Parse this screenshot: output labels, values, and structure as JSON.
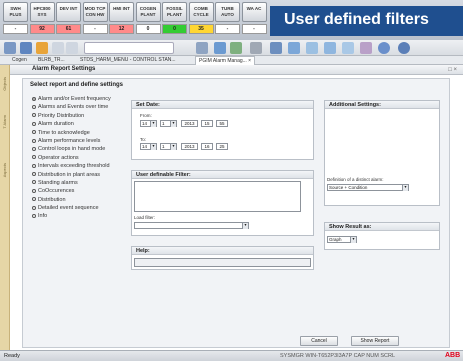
{
  "top_buttons": [
    {
      "label": "SWH PLUS",
      "value": "-",
      "color": "#ffffff"
    },
    {
      "label": "HPC800 SYS",
      "value": "92",
      "color": "#ff8a8a"
    },
    {
      "label": "DEV INT",
      "value": "61",
      "color": "#ff8a8a"
    },
    {
      "label": "MOD TCP CON HW",
      "value": "-",
      "color": "#ffffff"
    },
    {
      "label": "HMI INT",
      "value": "12",
      "color": "#ff8a8a"
    },
    {
      "label": "COGEN PLANT",
      "value": "0",
      "color": "#ffffff"
    },
    {
      "label": "FOSSIL PLANT",
      "value": "0",
      "color": "#33cc33"
    },
    {
      "label": "COMB CYCLE",
      "value": "35",
      "color": "#ffd633"
    },
    {
      "label": "TURB AUTO",
      "value": "-",
      "color": "#ffffff"
    },
    {
      "label": "WA AC",
      "value": "-",
      "color": "#ffffff"
    }
  ],
  "banner": "User defined filters",
  "tabs": {
    "t1": "Cogen",
    "t2": "BLRB_TR...",
    "t3": "STDS_HARM_MENU - CONTROL STAN...",
    "t4": "PGIM Alarm Manag... ×"
  },
  "left_strip": {
    "a": "Objects",
    "b": "T Alarm",
    "c": "Aspects"
  },
  "pane": {
    "title": "Alarm Report Settings",
    "controls": "□ ×"
  },
  "section_title": "Select report and define settings",
  "radio_items": [
    {
      "label": "Alarm and/or Event frequency",
      "selected": true
    },
    {
      "label": "Alarms and Events over time",
      "selected": false
    },
    {
      "label": "Priority Distribution",
      "selected": false
    },
    {
      "label": "Alarm duration",
      "selected": false
    },
    {
      "label": "Time to acknowledge",
      "selected": false
    },
    {
      "label": "Alarm performance levels",
      "selected": false
    },
    {
      "label": "Control loops in hand mode",
      "selected": false
    },
    {
      "label": "Operator actions",
      "selected": false
    },
    {
      "label": "Intervals exceeding threshold",
      "selected": false
    },
    {
      "label": "Distribution in plant areas",
      "selected": false
    },
    {
      "label": "Standing alarms",
      "selected": false
    },
    {
      "label": "CoOccurences",
      "selected": false
    },
    {
      "label": "Distribution",
      "selected": false
    },
    {
      "label": "Detailed event sequence",
      "selected": false
    },
    {
      "label": "Info",
      "selected": false
    }
  ],
  "start_date": {
    "title": "Set Date:",
    "from_label": "From:",
    "from": {
      "day": "14",
      "month": "1",
      "year": "2013",
      "hour": "15",
      "minute": "55"
    },
    "to_label": "To:",
    "to": {
      "day": "14",
      "month": "1",
      "year": "2013",
      "hour": "16",
      "minute": "25"
    }
  },
  "filter": {
    "title": "User definable Filter:",
    "load_label": "Load filter:",
    "load_value": ""
  },
  "help": {
    "title": "Help:"
  },
  "additional": {
    "title": "Additional Settings:",
    "definition_label": "Definition of a distinct alarm:",
    "definition_value": "Source + Condition"
  },
  "show_result": {
    "title": "Show Result as:",
    "value": "Graph"
  },
  "buttons": {
    "cancel": "Cancel",
    "show_report": "Show Report"
  },
  "status": {
    "left": "Ready",
    "right": "SYSMGR  WIN-T652P3I3A7P  CAP  NUM  SCRL",
    "brand": "ABB"
  }
}
